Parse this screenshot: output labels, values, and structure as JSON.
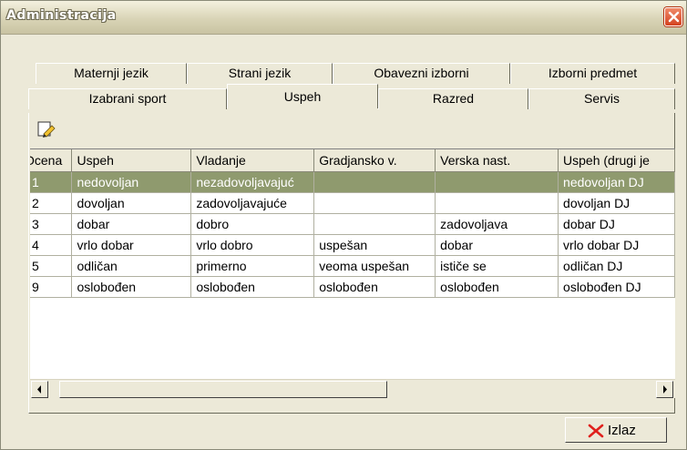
{
  "window": {
    "title": "Administracija"
  },
  "tabs_row1": [
    "Maternji jezik",
    "Strani jezik",
    "Obavezni izborni",
    "Izborni predmet"
  ],
  "tabs_row2": [
    "Izabrani sport",
    "Uspeh",
    "Razred",
    "Servis"
  ],
  "active_tab": "Uspeh",
  "toolbar": {
    "edit_icon": "pencil-edit-icon"
  },
  "table": {
    "columns": [
      "Ocena",
      "Uspeh",
      "Vladanje",
      "Gradjansko v.",
      "Verska nast.",
      "Uspeh (drugi je"
    ],
    "rows": [
      [
        "1",
        "nedovoljan",
        "nezadovoljavajuć",
        "",
        "",
        "nedovoljan DJ"
      ],
      [
        "2",
        "dovoljan",
        "zadovoljavajuće",
        "",
        "",
        "dovoljan DJ"
      ],
      [
        "3",
        "dobar",
        "dobro",
        "",
        "zadovoljava",
        "dobar DJ"
      ],
      [
        "4",
        "vrlo dobar",
        "vrlo dobro",
        "uspešan",
        "dobar",
        "vrlo dobar DJ"
      ],
      [
        "5",
        "odličan",
        "primerno",
        "veoma uspešan",
        "ističe se",
        "odličan DJ"
      ],
      [
        "9",
        "oslobođen",
        "oslobođen",
        "oslobođen",
        "oslobođen",
        "oslobođen DJ"
      ]
    ],
    "selected_row": 0
  },
  "footer": {
    "exit_label": "Izlaz"
  },
  "colors": {
    "selection": "#8f9a6e",
    "exit_x": "#e0201c",
    "close_bg": "#d4421f"
  }
}
